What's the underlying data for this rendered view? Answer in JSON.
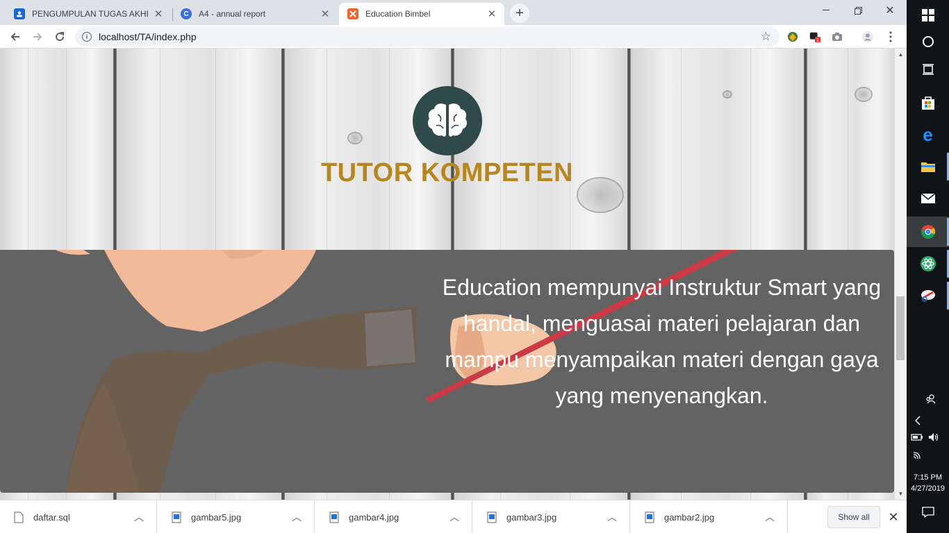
{
  "browser": {
    "tabs": [
      {
        "title": "PENGUMPULAN TUGAS AKHIR W",
        "icon": "classroom-icon",
        "active": false
      },
      {
        "title": "A4 - annual report",
        "icon": "canva-icon",
        "active": false
      },
      {
        "title": "Education Bimbel",
        "icon": "xampp-icon",
        "active": true
      }
    ],
    "new_tab_glyph": "+",
    "url": "localhost/TA/index.php"
  },
  "page": {
    "heading": "TUTOR KOMPETEN",
    "description": "Education mempunyai Instruktur Smart yang handal, menguasai materi pelajaran dan mampu menyampaikan materi dengan gaya yang menyenangkan.",
    "colors": {
      "heading": "#b7861e",
      "badge": "#2e4a4a",
      "panel": "#636363"
    }
  },
  "downloads": {
    "items": [
      {
        "name": "daftar.sql",
        "icon": "file-icon"
      },
      {
        "name": "gambar5.jpg",
        "icon": "image-file-icon"
      },
      {
        "name": "gambar4.jpg",
        "icon": "image-file-icon"
      },
      {
        "name": "gambar3.jpg",
        "icon": "image-file-icon"
      },
      {
        "name": "gambar2.jpg",
        "icon": "image-file-icon"
      }
    ],
    "show_all": "Show all"
  },
  "taskbar": {
    "time": "7:15 PM",
    "date": "4/27/2019"
  }
}
